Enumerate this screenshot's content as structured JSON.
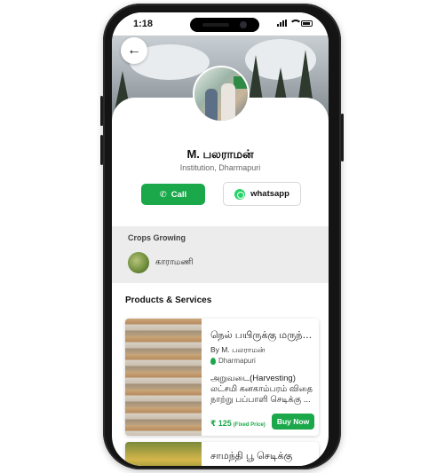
{
  "status_bar": {
    "time": "1:18"
  },
  "profile": {
    "name": "M. பலராமன்",
    "subtitle": "Institution, Dharmapuri",
    "call_label": "Call",
    "whatsapp_label": "whatsapp"
  },
  "crops": {
    "title": "Crops Growing",
    "items": [
      {
        "label": "காராமணி"
      }
    ]
  },
  "products": {
    "title": "Products & Services",
    "items": [
      {
        "title": "நெல் பயிருக்கு மருந்…",
        "by": "By M. பலராமன்",
        "location": "Dharmapuri",
        "desc_line1": "அறுவடை(Harvesting)",
        "desc_line2": "லட்சமி கனகாம்பரம் விதை",
        "desc_line3": "நாற்று பப்பாளி செடிக்கு ...",
        "price": "₹ 125",
        "price_note": "(Fixed Price)",
        "buy_label": "Buy Now"
      },
      {
        "title": "சாமந்தி பூ செடிக்கு"
      }
    ]
  },
  "colors": {
    "accent": "#1aa84a",
    "whatsapp": "#25d366"
  }
}
